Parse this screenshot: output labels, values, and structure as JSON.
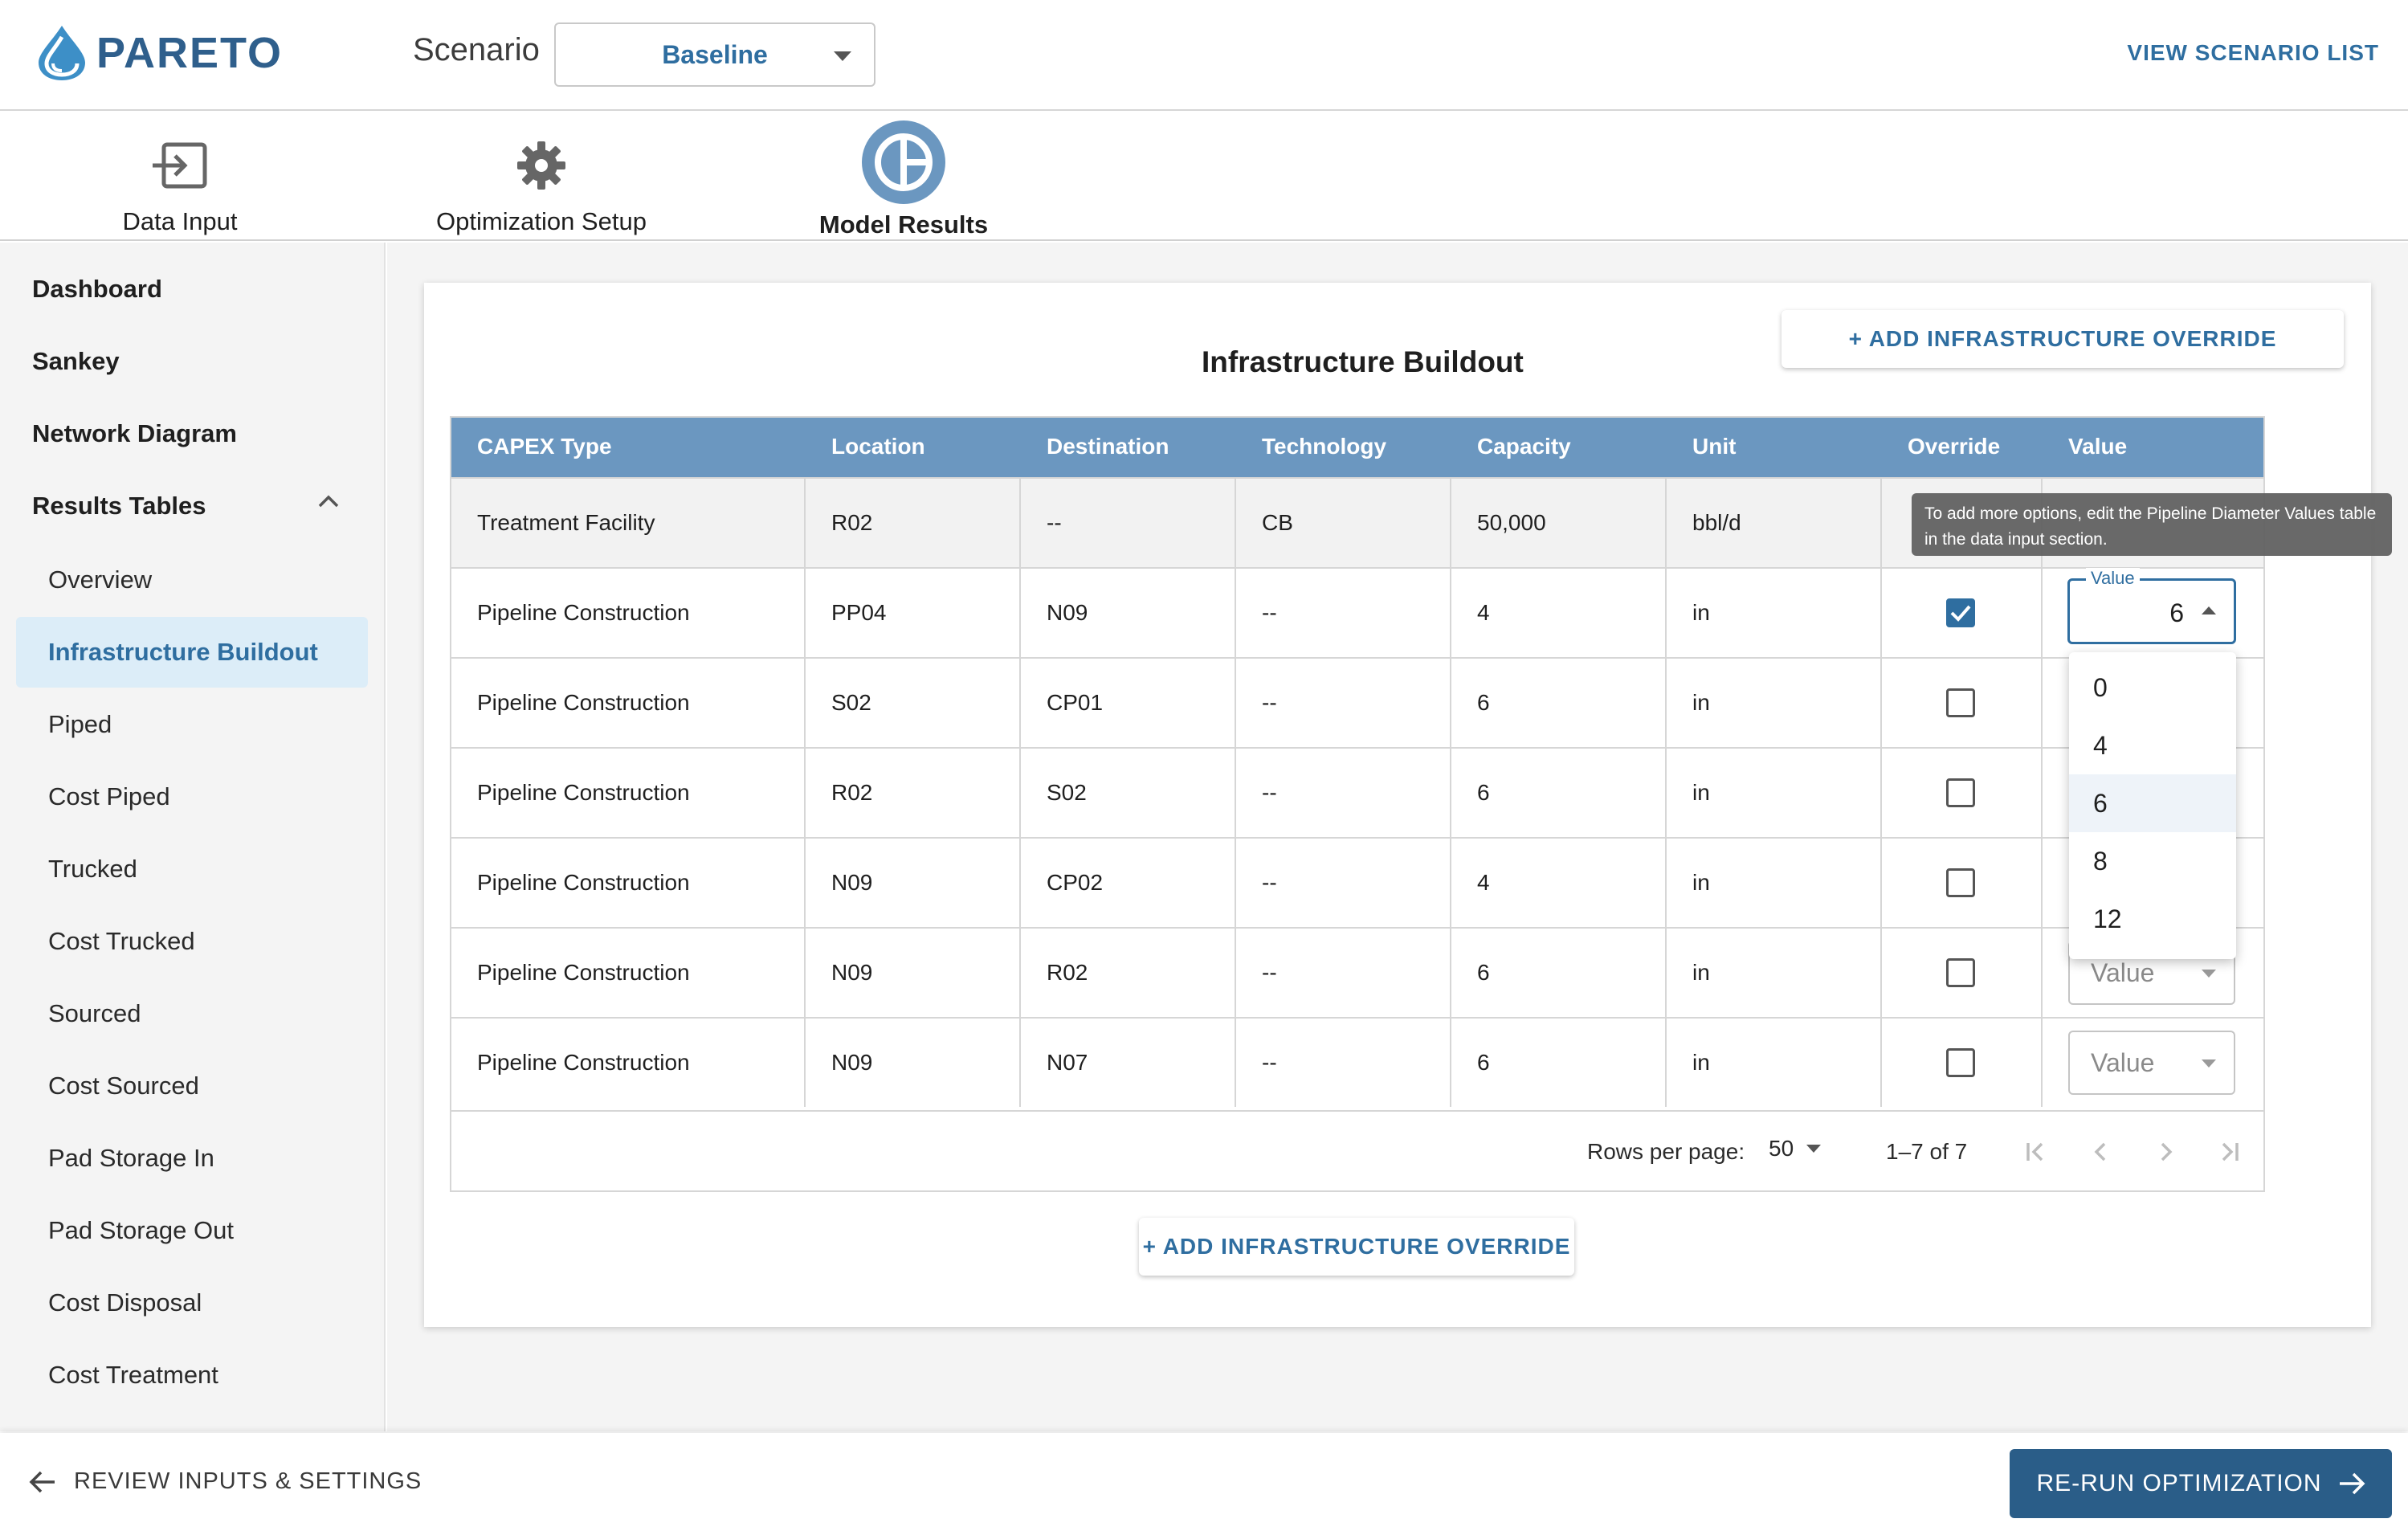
{
  "app": {
    "logo_text": "PARETO"
  },
  "header": {
    "scenario_label": "Scenario",
    "scenario_value": "Baseline",
    "view_scenario_list": "VIEW SCENARIO LIST"
  },
  "tabs": [
    {
      "label": "Data Input",
      "icon": "input-icon"
    },
    {
      "label": "Optimization Setup",
      "icon": "gear-icon"
    },
    {
      "label": "Model Results",
      "icon": "chart-icon",
      "active": true
    }
  ],
  "sidebar": {
    "top_items": [
      "Dashboard",
      "Sankey",
      "Network Diagram",
      "Results Tables"
    ],
    "sub_items": [
      "Overview",
      "Infrastructure Buildout",
      "Piped",
      "Cost Piped",
      "Trucked",
      "Cost Trucked",
      "Sourced",
      "Cost Sourced",
      "Pad Storage In",
      "Pad Storage Out",
      "Cost Disposal",
      "Cost Treatment"
    ],
    "active_sub": "Infrastructure Buildout"
  },
  "main": {
    "title": "Infrastructure Buildout",
    "add_override_label": "+ ADD INFRASTRUCTURE OVERRIDE",
    "columns": [
      "CAPEX Type",
      "Location",
      "Destination",
      "Technology",
      "Capacity",
      "Unit",
      "Override",
      "Value"
    ],
    "rows": [
      {
        "capex": "Treatment Facility",
        "location": "R02",
        "destination": "--",
        "technology": "CB",
        "capacity": "50,000",
        "unit": "bbl/d",
        "override": null,
        "value": ""
      },
      {
        "capex": "Pipeline Construction",
        "location": "PP04",
        "destination": "N09",
        "technology": "--",
        "capacity": "4",
        "unit": "in",
        "override": true,
        "value": "6"
      },
      {
        "capex": "Pipeline Construction",
        "location": "S02",
        "destination": "CP01",
        "technology": "--",
        "capacity": "6",
        "unit": "in",
        "override": false,
        "value": ""
      },
      {
        "capex": "Pipeline Construction",
        "location": "R02",
        "destination": "S02",
        "technology": "--",
        "capacity": "6",
        "unit": "in",
        "override": false,
        "value": ""
      },
      {
        "capex": "Pipeline Construction",
        "location": "N09",
        "destination": "CP02",
        "technology": "--",
        "capacity": "4",
        "unit": "in",
        "override": false,
        "value": ""
      },
      {
        "capex": "Pipeline Construction",
        "location": "N09",
        "destination": "R02",
        "technology": "--",
        "capacity": "6",
        "unit": "in",
        "override": false,
        "value": "Value"
      },
      {
        "capex": "Pipeline Construction",
        "location": "N09",
        "destination": "N07",
        "technology": "--",
        "capacity": "6",
        "unit": "in",
        "override": false,
        "value": "Value"
      }
    ],
    "pagination": {
      "rows_per_page_label": "Rows per page:",
      "rows_per_page_value": "50",
      "range": "1–7 of 7"
    },
    "value_select": {
      "legend": "Value",
      "current": "6",
      "options": [
        "0",
        "4",
        "6",
        "8",
        "12"
      ],
      "selected": "6"
    },
    "tooltip": "To add more options, edit the Pipeline Diameter Values table in the data input section."
  },
  "footer": {
    "review_label": "REVIEW INPUTS & SETTINGS",
    "rerun_label": "RE-RUN OPTIMIZATION"
  },
  "colors": {
    "accent": "#2f6ea0",
    "header_row": "#6b97c0",
    "primary_button": "#2a5d88",
    "active_sidebar_bg": "#dcedf8"
  }
}
